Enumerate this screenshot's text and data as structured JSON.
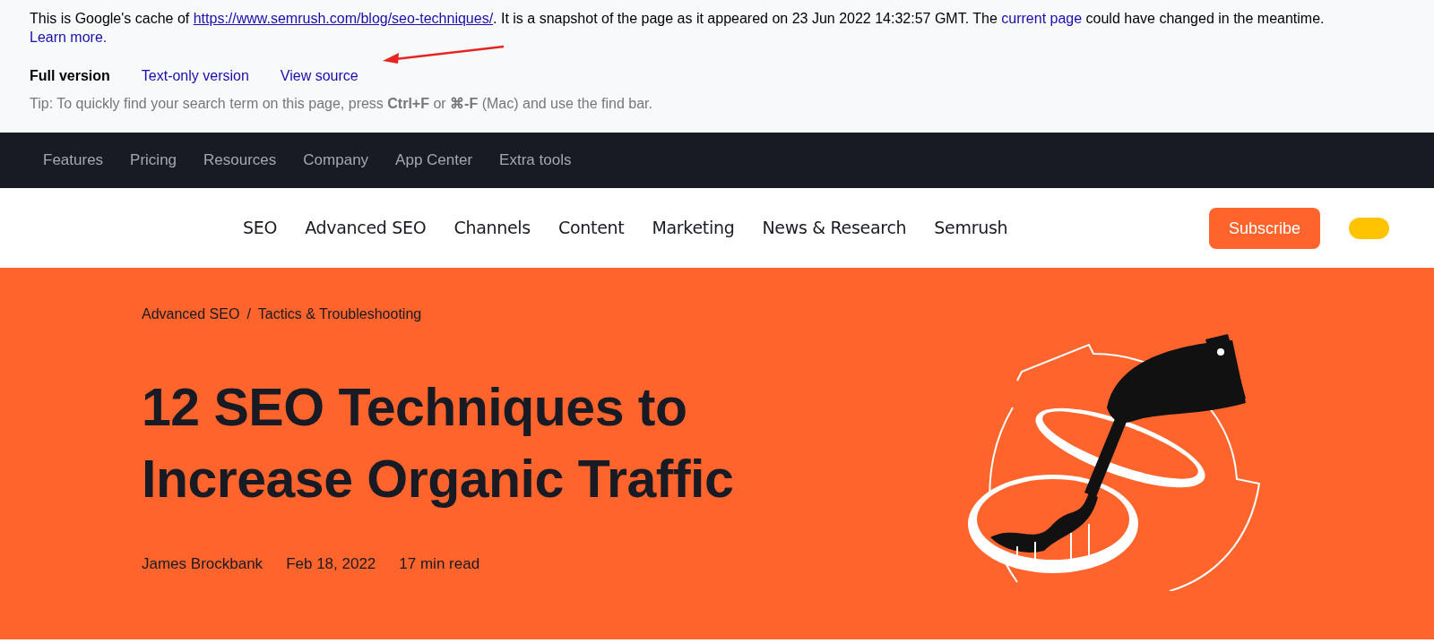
{
  "cache_notice": {
    "segments": [
      {
        "kind": "text",
        "text": "This is Google's cache of "
      },
      {
        "kind": "url",
        "text": "https://www.semrush.com/blog/seo-techniques/"
      },
      {
        "kind": "text",
        "text": ". It is a snapshot of the page as it appeared on 23 Jun 2022 14:32:57 GMT. The "
      },
      {
        "kind": "link",
        "text": "current page"
      },
      {
        "kind": "text",
        "text": " could have changed in the meantime. "
      },
      {
        "kind": "link",
        "text": "Learn more."
      }
    ],
    "versions": [
      {
        "label": "Full version",
        "selected": true
      },
      {
        "label": "Text-only version",
        "selected": false
      },
      {
        "label": "View source",
        "selected": false
      }
    ],
    "tip": "Tip: To quickly find your search term on this page, press **Ctrl+F** or **⌘-F** (Mac) and use the find bar."
  },
  "top_nav": [
    "Features",
    "Pricing",
    "Resources",
    "Company",
    "App Center",
    "Extra tools"
  ],
  "main_nav": {
    "items": [
      "SEO",
      "Advanced SEO",
      "Channels",
      "Content",
      "Marketing",
      "News & Research",
      "Semrush"
    ],
    "subscribe": "Subscribe"
  },
  "hero": {
    "breadcrumb": [
      "Advanced SEO",
      "Tactics & Troubleshooting"
    ],
    "separator": "/",
    "title_lines": [
      "12 SEO Techniques to",
      "Increase Organic Traffic"
    ],
    "meta": [
      "James Brockbank",
      "Feb 18, 2022",
      "17 min read"
    ]
  }
}
